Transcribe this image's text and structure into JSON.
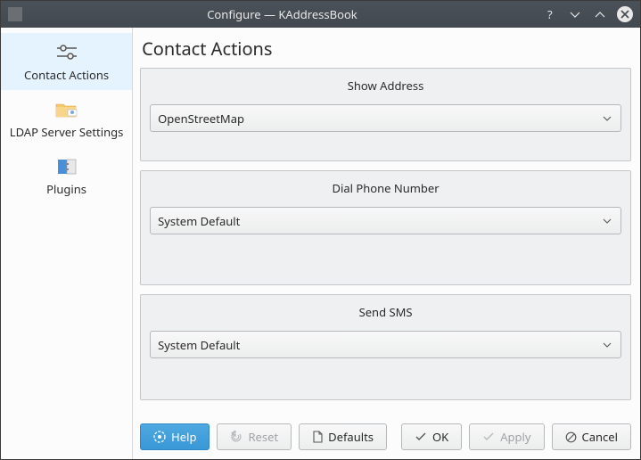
{
  "window": {
    "title": "Configure — KAddressBook"
  },
  "sidebar": {
    "items": [
      {
        "label": "Contact Actions",
        "icon": "sliders"
      },
      {
        "label": "LDAP Server Settings",
        "icon": "folder-network"
      },
      {
        "label": "Plugins",
        "icon": "plugin"
      }
    ]
  },
  "main": {
    "title": "Contact Actions",
    "groups": [
      {
        "title": "Show Address",
        "value": "OpenStreetMap"
      },
      {
        "title": "Dial Phone Number",
        "value": "System Default"
      },
      {
        "title": "Send SMS",
        "value": "System Default"
      }
    ]
  },
  "buttons": {
    "help": "Help",
    "reset": "Reset",
    "defaults": "Defaults",
    "ok": "OK",
    "apply": "Apply",
    "cancel": "Cancel"
  }
}
